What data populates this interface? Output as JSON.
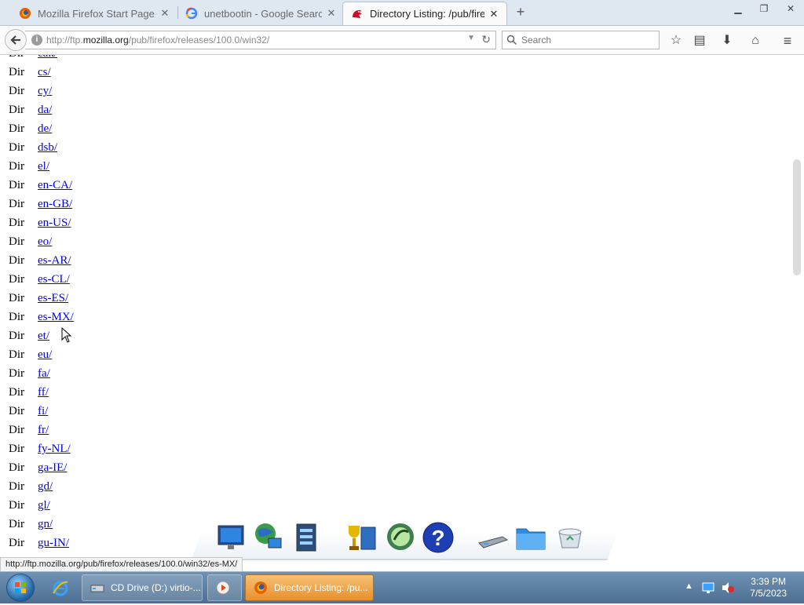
{
  "tabs": [
    {
      "title": "Mozilla Firefox Start Page",
      "state": "inactive",
      "icon": "firefox-icon"
    },
    {
      "title": "unetbootin - Google Search",
      "state": "inactive",
      "icon": "google-icon"
    },
    {
      "title": "Directory Listing: /pub/fire...",
      "state": "active",
      "icon": "ftp-dragon-icon"
    }
  ],
  "navbar": {
    "url_prefix": "http://ftp.",
    "url_host": "mozilla.org",
    "url_path": "/pub/firefox/releases/100.0/win32/",
    "search_placeholder": "Search"
  },
  "listing": [
    {
      "type": "Dir",
      "name": "cak/"
    },
    {
      "type": "Dir",
      "name": "cs/"
    },
    {
      "type": "Dir",
      "name": "cy/"
    },
    {
      "type": "Dir",
      "name": "da/"
    },
    {
      "type": "Dir",
      "name": "de/"
    },
    {
      "type": "Dir",
      "name": "dsb/"
    },
    {
      "type": "Dir",
      "name": "el/"
    },
    {
      "type": "Dir",
      "name": "en-CA/"
    },
    {
      "type": "Dir",
      "name": "en-GB/"
    },
    {
      "type": "Dir",
      "name": "en-US/"
    },
    {
      "type": "Dir",
      "name": "eo/"
    },
    {
      "type": "Dir",
      "name": "es-AR/"
    },
    {
      "type": "Dir",
      "name": "es-CL/"
    },
    {
      "type": "Dir",
      "name": "es-ES/"
    },
    {
      "type": "Dir",
      "name": "es-MX/"
    },
    {
      "type": "Dir",
      "name": "et/"
    },
    {
      "type": "Dir",
      "name": "eu/"
    },
    {
      "type": "Dir",
      "name": "fa/"
    },
    {
      "type": "Dir",
      "name": "ff/"
    },
    {
      "type": "Dir",
      "name": "fi/"
    },
    {
      "type": "Dir",
      "name": "fr/"
    },
    {
      "type": "Dir",
      "name": "fy-NL/"
    },
    {
      "type": "Dir",
      "name": "ga-IE/"
    },
    {
      "type": "Dir",
      "name": "gd/"
    },
    {
      "type": "Dir",
      "name": "gl/"
    },
    {
      "type": "Dir",
      "name": "gn/"
    },
    {
      "type": "Dir",
      "name": "gu-IN/"
    }
  ],
  "status_link": "http://ftp.mozilla.org/pub/firefox/releases/100.0/win32/es-MX/",
  "taskbar": {
    "buttons": [
      {
        "label": "CD Drive (D:) virtio-...",
        "state": "normal"
      },
      {
        "label": "",
        "state": "normal"
      },
      {
        "label": "Directory Listing: /pu...",
        "state": "active"
      }
    ],
    "time": "3:39 PM",
    "date": "7/5/2023"
  },
  "dock_icons": [
    "computer-icon",
    "network-icon",
    "control-panel-icon",
    "games-icon",
    "media-center-icon",
    "help-icon",
    "drive-icon",
    "folder-icon",
    "recycle-bin-icon"
  ]
}
